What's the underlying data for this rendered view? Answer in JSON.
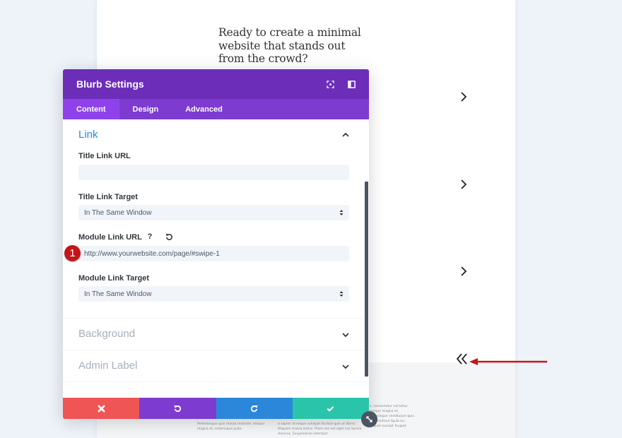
{
  "page": {
    "hero_text": "Ready to create a minimal website that stands out from the crowd?",
    "filler_left": "Pellentesque quis massa molestie, tempor magna et, scelerisque justo.",
    "filler_mid": "a sapien id neque volutpat facilisis quis ut libero. Aliquam massa lectus. Proin non est eget nisl lacinia rhoncus. Suspendisse interdum",
    "filler_right": "s, consectetur vel tellus tempor magna et, scelerisque vestibulum quis. Suspendisse ligula eu, aliquet suscipit feugiat.",
    "annotation_color": "#c41618"
  },
  "panel": {
    "title": "Blurb Settings",
    "header_icons": [
      "fullscreen-icon",
      "sidebar-layout-icon"
    ],
    "tabs": [
      {
        "label": "Content",
        "active": true
      },
      {
        "label": "Design",
        "active": false
      },
      {
        "label": "Advanced",
        "active": false
      }
    ],
    "sections": {
      "link": {
        "title": "Link",
        "expanded": true,
        "fields": {
          "title_link_url": {
            "label": "Title Link URL",
            "value": ""
          },
          "title_link_target": {
            "label": "Title Link Target",
            "value": "In The Same Window"
          },
          "module_link_url": {
            "label": "Module Link URL",
            "value": "http://www.yourwebsite.com/page/#swipe-1",
            "help": "?"
          },
          "module_link_target": {
            "label": "Module Link Target",
            "value": "In The Same Window"
          }
        }
      },
      "background": {
        "title": "Background",
        "expanded": false
      },
      "admin_label": {
        "title": "Admin Label",
        "expanded": false
      }
    },
    "badge": "1",
    "footer": {
      "cancel": "close-icon",
      "undo": "undo-icon",
      "redo": "redo-icon",
      "save": "checkmark-icon"
    },
    "colors": {
      "header": "#6c2eb9",
      "tabs": "#7e3bd0",
      "active_tab": "#8f42ec",
      "section_open": "#2b87da",
      "cancel": "#ef5555",
      "undo": "#7e3bd0",
      "redo": "#2b87da",
      "save": "#29c4a9"
    }
  }
}
